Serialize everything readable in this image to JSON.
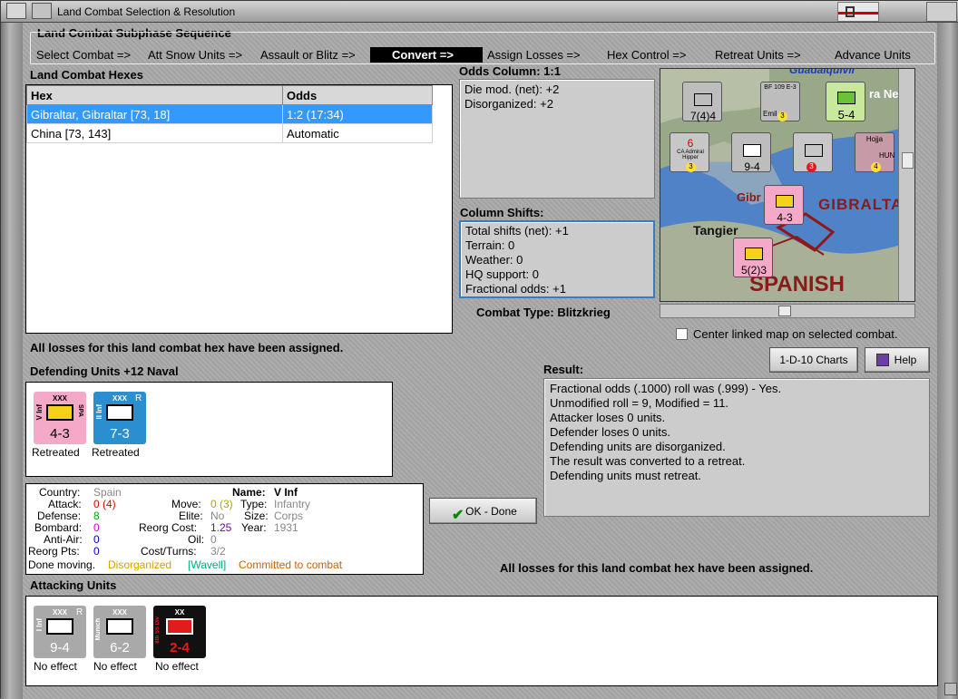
{
  "window": {
    "title": "Land Combat Selection & Resolution"
  },
  "sequence": {
    "title": "Land Combat Subphase Sequence",
    "steps": [
      "Select Combat =>",
      "Att Snow Units =>",
      "Assault or Blitz =>",
      "Convert =>",
      "Assign Losses =>",
      "Hex Control =>",
      "Retreat Units =>",
      "Advance Units"
    ],
    "current": "Convert =>"
  },
  "hexes": {
    "title": "Land Combat Hexes",
    "columns": [
      "Hex",
      "Odds"
    ],
    "rows": [
      {
        "hex": "Gibraltar, Gibraltar [73, 18]",
        "odds": "1:2 (17:34)",
        "selected": true
      },
      {
        "hex": "China [73, 143]",
        "odds": "Automatic",
        "selected": false
      }
    ]
  },
  "odds": {
    "title": "Odds Column: 1:1",
    "lines": [
      "Die mod. (net): +2",
      "Disorganized: +2"
    ]
  },
  "shifts": {
    "title": "Column Shifts:",
    "lines": [
      "Total shifts (net): +1",
      "Terrain: 0",
      "Weather: 0",
      "HQ support: 0",
      "Fractional odds: +1"
    ]
  },
  "combat_type": "Combat Type:  Blitzkrieg",
  "center_map": "Center linked map on selected combat.",
  "buttons": {
    "charts": "1-D-10 Charts",
    "help": "Help",
    "ok": "OK - Done"
  },
  "losses_msg_1": "All losses for this land combat hex have been assigned.",
  "losses_msg_2": "All losses for this land combat hex have been assigned.",
  "defending": {
    "title": "Defending Units +12 Naval",
    "units": [
      {
        "label": "V Inf",
        "size": "XXX",
        "strength": "4-3",
        "side": "SPA",
        "status": "Retreated",
        "color": "#f5a9c8"
      },
      {
        "label": "II Inf",
        "size": "XXX",
        "strength": "7-3",
        "side": "R",
        "status": "Retreated",
        "color": "#2b8fcf"
      }
    ]
  },
  "result": {
    "title": "Result:",
    "lines": [
      "Fractional odds (.1000) roll was (.999)  - Yes.",
      "Unmodified roll = 9, Modified = 11.",
      "Attacker loses 0 units.",
      "Defender loses 0 units.",
      "Defending units are disorganized.",
      "The result was converted to a retreat.",
      "Defending units must retreat."
    ]
  },
  "unit_info": {
    "country_l": "Country:",
    "country_v": "Spain",
    "attack_l": "Attack:",
    "attack_v": "0 (4)",
    "defense_l": "Defense:",
    "defense_v": "8",
    "bombard_l": "Bombard:",
    "bombard_v": "0",
    "aa_l": "Anti-Air:",
    "aa_v": "0",
    "reorgpts_l": "Reorg Pts:",
    "reorgpts_v": "0",
    "name_l": "Name:",
    "name_v": "V Inf",
    "move_l": "Move:",
    "move_v": "0 (3)",
    "type_l": "Type:",
    "type_v": "Infantry",
    "elite_l": "Elite:",
    "elite_v": "No",
    "size_l": "Size:",
    "size_v": "Corps",
    "reorgcost_l": "Reorg Cost:",
    "reorgcost_v": "1.25",
    "year_l": "Year:",
    "year_v": "1931",
    "oil_l": "Oil:",
    "oil_v": "0",
    "costturns_l": "Cost/Turns:",
    "costturns_v": "3/2",
    "status_1": "Done moving.",
    "status_2": "Disorganized",
    "status_3": "[Wavell]",
    "status_4": "Committed to combat"
  },
  "attacking": {
    "title": "Attacking Units",
    "units": [
      {
        "label": "I Inf",
        "size": "XXX",
        "strength": "9-4",
        "side": "R",
        "status": "No effect",
        "color": "#a9a9a9"
      },
      {
        "label": "Munich",
        "size": "XXX",
        "strength": "6-2",
        "side": "",
        "status": "No effect",
        "color": "#a9a9a9"
      },
      {
        "label": "8th SS Div",
        "size": "XX",
        "strength": "2-4",
        "side": "",
        "status": "No effect",
        "color": "#111111"
      }
    ]
  },
  "map": {
    "labels": [
      "GIBRALTAR",
      "Tangier",
      "SPANISH",
      "Guadalquivir",
      "ra Neva",
      "Gibr"
    ],
    "counters": [
      "7(4)4",
      "5-4",
      "9-4",
      "4-3",
      "5(2)3",
      "Emil",
      "Hojja",
      "HUN",
      "CA Admiral Hipper",
      "BF 109 E-3"
    ]
  }
}
